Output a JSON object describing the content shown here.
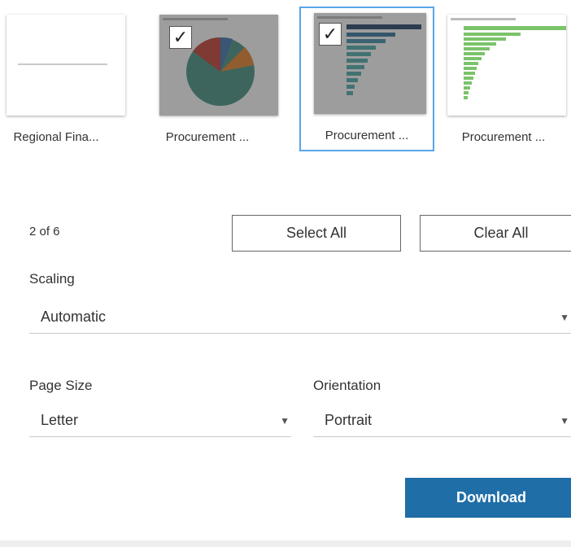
{
  "sheets": [
    {
      "label": "Regional Fina...",
      "selected": false,
      "checked": false
    },
    {
      "label": "Procurement ...",
      "selected": false,
      "checked": true
    },
    {
      "label": "Procurement ...",
      "selected": true,
      "checked": true
    },
    {
      "label": "Procurement ...",
      "selected": false,
      "checked": false
    }
  ],
  "selection": {
    "count_text": "2 of 6"
  },
  "buttons": {
    "select_all": "Select All",
    "clear_all": "Clear All",
    "download": "Download"
  },
  "scaling": {
    "label": "Scaling",
    "value": "Automatic"
  },
  "page_size": {
    "label": "Page Size",
    "value": "Letter"
  },
  "orientation": {
    "label": "Orientation",
    "value": "Portrait"
  },
  "icons": {
    "check": "checkmark-icon",
    "caret": "caret-down-icon"
  },
  "colors": {
    "accent": "#1f6ea8",
    "selected_border": "#5aa5e8",
    "bar_dark": "#1f3b63",
    "bar_teal": "#4aa8a8",
    "bar_green": "#7ac36a",
    "pie_teal": "#3f8f7f",
    "pie_red": "#c0392b",
    "pie_orange": "#e67e22",
    "pie_blue": "#3a6fb0"
  }
}
